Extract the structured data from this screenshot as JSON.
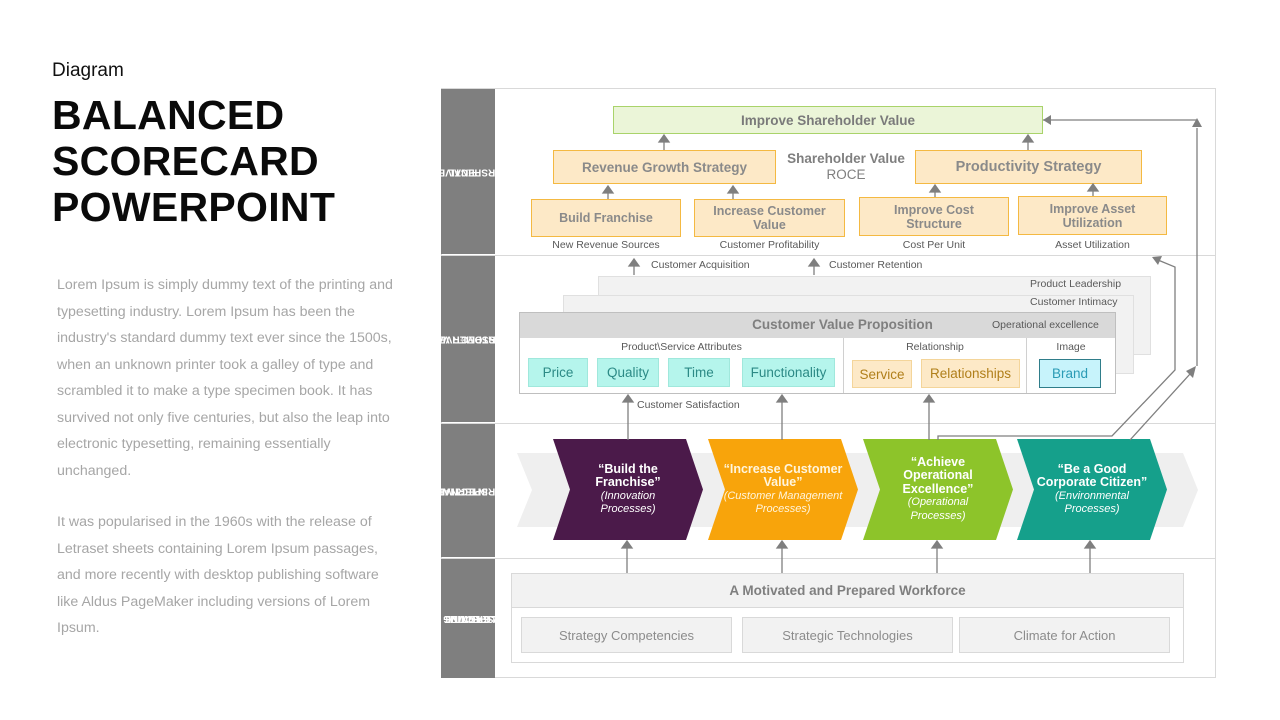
{
  "header": {
    "kicker": "Diagram",
    "title_lines": [
      "BALANCED",
      "SCORECARD",
      "POWERPOINT"
    ]
  },
  "body_text": {
    "paragraph1": "Lorem Ipsum is simply dummy text of the printing and typesetting industry. Lorem Ipsum has been the industry's standard dummy text ever since the 1500s, when an unknown printer took a galley of type and scrambled it to make a type specimen book. It has survived not only five centuries, but also the leap into electronic typesetting, remaining essentially unchanged.",
    "paragraph2": "It was popularised in the 1960s with the release of Letraset sheets containing Lorem Ipsum passages, and more recently with desktop publishing software like Aldus PageMaker including versions of Lorem Ipsum."
  },
  "perspectives": {
    "final": "FINAL PERSPECTIVE",
    "final_lines": [
      "FINAL",
      "PERSPECTIVE"
    ],
    "customer_lines": [
      "CUSTOMER VALUE",
      "PERSPECTIVE"
    ],
    "internal_lines": [
      "INTERNAL",
      "PERSPECTIVE"
    ],
    "learning_lines": [
      "LEARNING AND",
      "GROWTH",
      "PERSPECTIVE"
    ]
  },
  "financial": {
    "top_goal": "Improve Shareholder Value",
    "center_label_line1": "Shareholder Value",
    "center_label_line2": "ROCE",
    "revenue_strategy": "Revenue Growth Strategy",
    "productivity_strategy": "Productivity Strategy",
    "sub_objectives": [
      {
        "label_line1": "Build Franchise",
        "label_line2": "",
        "measure": "New Revenue Sources"
      },
      {
        "label_line1": "Increase Customer",
        "label_line2": "Value",
        "measure": "Customer Profitability"
      },
      {
        "label_line1": "Improve Cost",
        "label_line2": "Structure",
        "measure": "Cost Per Unit"
      },
      {
        "label_line1": "Improve Asset",
        "label_line2": "Utilization",
        "measure": "Asset Utilization"
      }
    ]
  },
  "customer": {
    "acquisition": "Customer Acquisition",
    "retention": "Customer Retention",
    "satisfaction": "Customer Satisfaction",
    "stack_labels": [
      "Product Leadership",
      "Customer Intimacy",
      "Operational excellence"
    ],
    "cvp_title": "Customer  Value Proposition",
    "groups": [
      {
        "title": "Product\\Service Attributes",
        "items": [
          "Price",
          "Quality",
          "Time",
          "Functionality"
        ]
      },
      {
        "title": "Relationship",
        "items": [
          "Service",
          "Relationships"
        ]
      },
      {
        "title": "Image",
        "items": [
          "Brand"
        ]
      }
    ]
  },
  "internal": {
    "processes": [
      {
        "line1": "“Build the",
        "line2": "Franchise”",
        "line3": "",
        "sub1": "(Innovation",
        "sub2": "Processes)",
        "color": "#4b1a4a"
      },
      {
        "line1": "“Increase Customer",
        "line2": "Value”",
        "line3": "",
        "sub1": "(Customer Management",
        "sub2": "Processes)",
        "color": "#f8a40b"
      },
      {
        "line1": "“Achieve",
        "line2": "Operational",
        "line3": "Excellence”",
        "sub1": "(Operational",
        "sub2": "Processes)",
        "color": "#8dc42a"
      },
      {
        "line1": "“Be a Good",
        "line2": "Corporate Citizen”",
        "line3": "",
        "sub1": "(Environmental",
        "sub2": "Processes)",
        "color": "#15a08b"
      }
    ]
  },
  "learning": {
    "head": "A Motivated and Prepared Workforce",
    "items": [
      "Strategy Competencies",
      "Strategic Technologies",
      "Climate for Action"
    ]
  }
}
